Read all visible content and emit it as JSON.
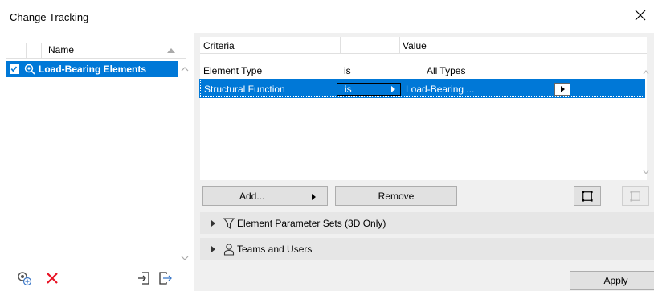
{
  "window": {
    "title": "Change Tracking"
  },
  "left_panel": {
    "header_name": "Name",
    "items": [
      {
        "label": "Load-Bearing Elements",
        "checked": true,
        "selected": true
      }
    ]
  },
  "criteria_table": {
    "headers": {
      "criteria": "Criteria",
      "value": "Value"
    },
    "rows": [
      {
        "criteria": "Element Type",
        "operator": "is",
        "value": "All Types"
      },
      {
        "criteria": "Structural Function",
        "operator": "is",
        "value": "Load-Bearing ...",
        "selected": true
      }
    ]
  },
  "buttons": {
    "add": "Add...",
    "remove": "Remove",
    "apply": "Apply"
  },
  "sections": [
    {
      "label": "Element Parameter Sets (3D Only)",
      "icon": "filter-icon"
    },
    {
      "label": "Teams and Users",
      "icon": "user-icon"
    }
  ],
  "colors": {
    "selection": "#0078d7",
    "panel_bg": "#f0f0f0",
    "delete_red": "#e81123"
  }
}
